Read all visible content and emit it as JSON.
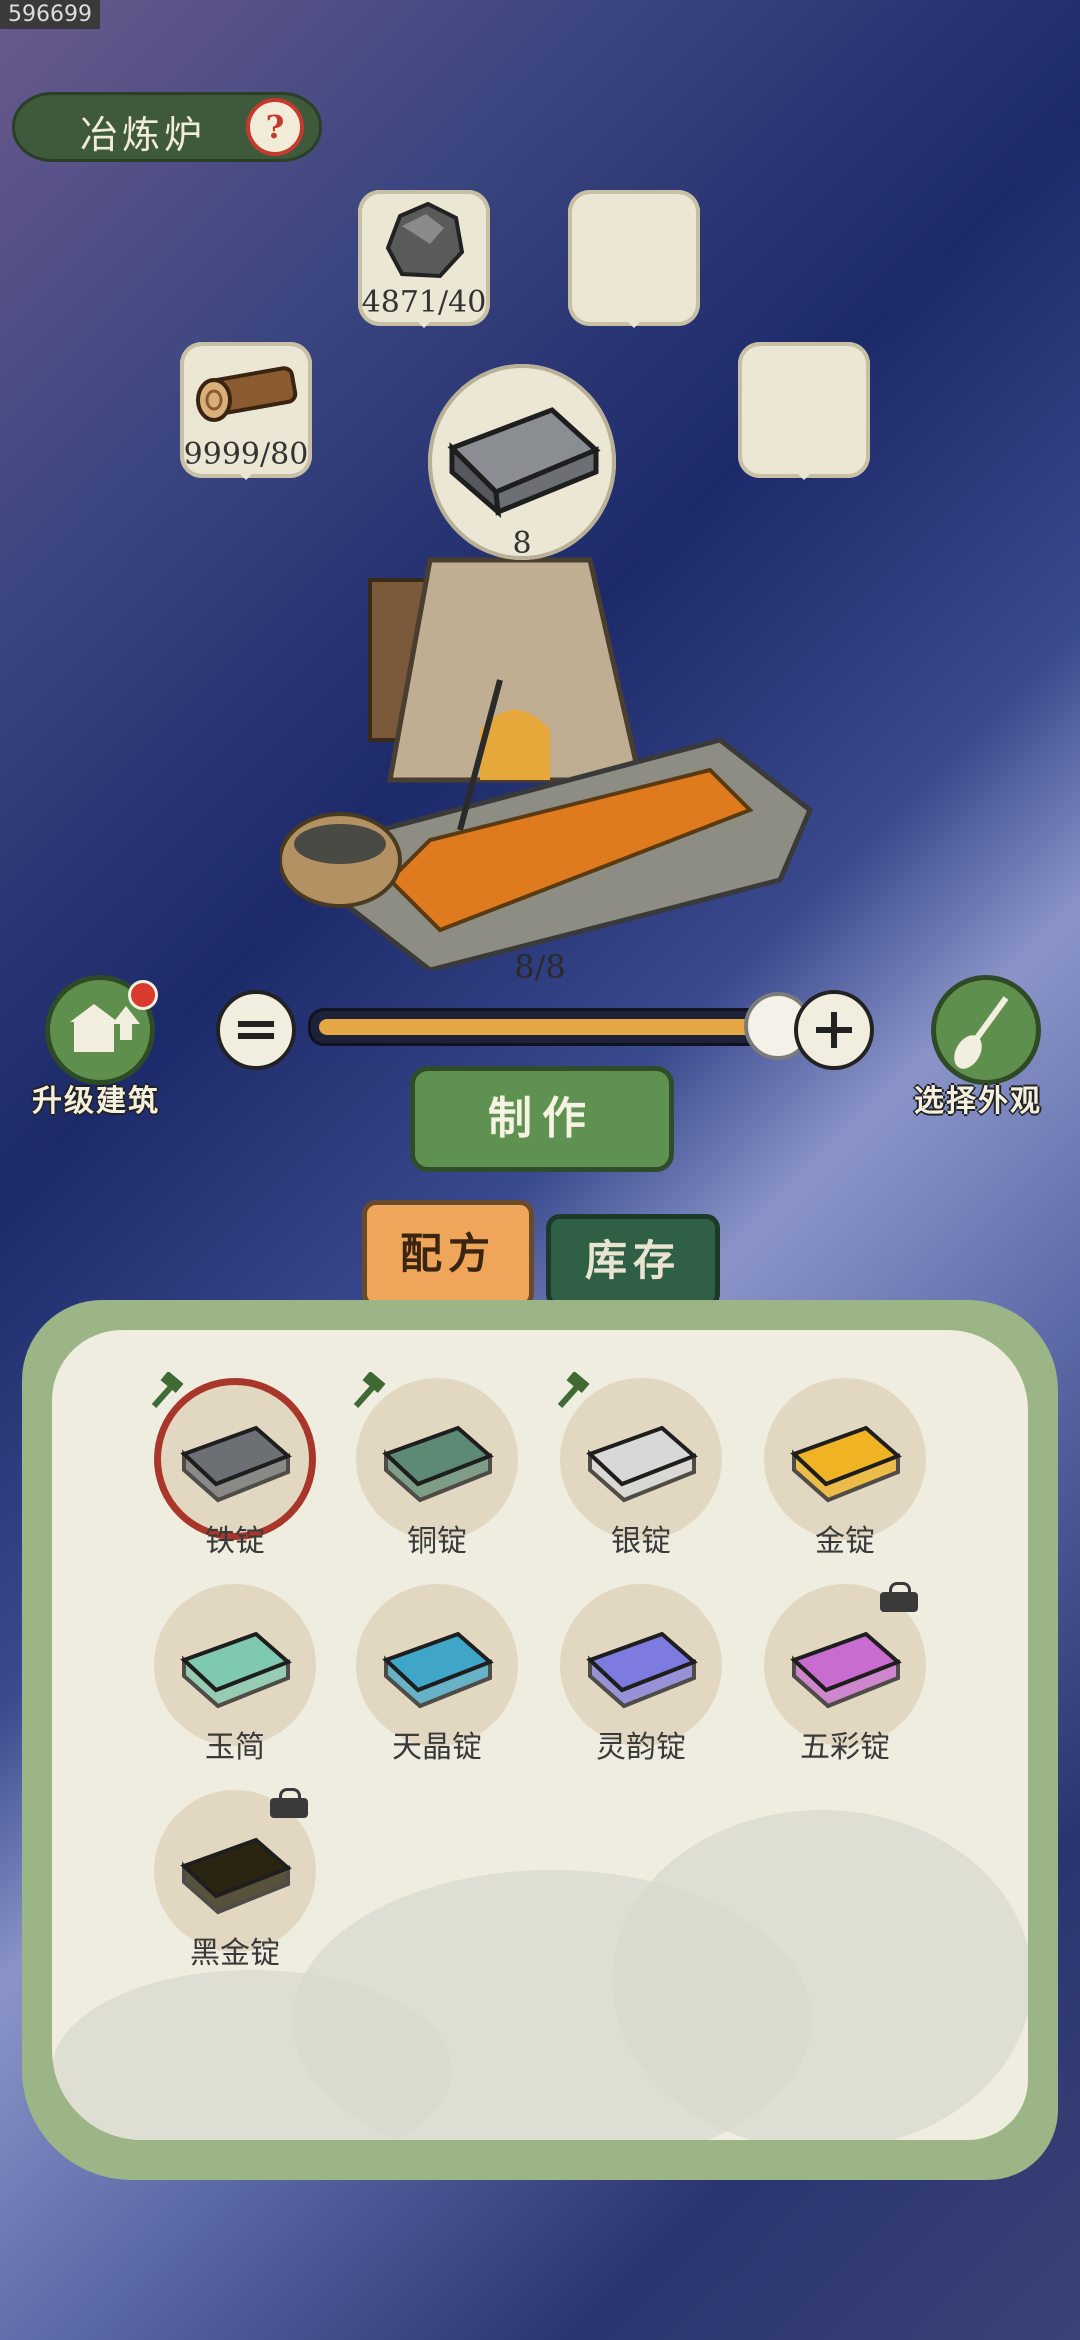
{
  "debug_id": "596699",
  "header": {
    "title": "冶炼炉",
    "help_icon": "question-icon"
  },
  "materials": [
    {
      "icon": "ore-icon",
      "count": "4871/40"
    },
    {
      "icon": "",
      "count": ""
    },
    {
      "icon": "log-icon",
      "count": "9999/80"
    },
    {
      "icon": "",
      "count": ""
    }
  ],
  "output": {
    "icon": "iron-ingot-icon",
    "count": "8"
  },
  "batch": {
    "display": "8/8",
    "current": 8,
    "max": 8
  },
  "actions": {
    "upgrade_label": "升级建筑",
    "appearance_label": "选择外观",
    "make_label": "制作"
  },
  "tabs": [
    {
      "label": "配方",
      "active": true
    },
    {
      "label": "库存",
      "active": false
    }
  ],
  "recipes": [
    {
      "name": "铁锭",
      "color": "#6c6f74",
      "hammer": true,
      "selected": true,
      "locked": false
    },
    {
      "name": "铜锭",
      "color": "#5d8a74",
      "hammer": true,
      "selected": false,
      "locked": false
    },
    {
      "name": "银锭",
      "color": "#d8d8d8",
      "hammer": true,
      "selected": false,
      "locked": false
    },
    {
      "name": "金锭",
      "color": "#f0b324",
      "hammer": false,
      "selected": false,
      "locked": false
    },
    {
      "name": "玉简",
      "color": "#7fc9b0",
      "hammer": false,
      "selected": false,
      "locked": false
    },
    {
      "name": "天晶锭",
      "color": "#3fa6c8",
      "hammer": false,
      "selected": false,
      "locked": false
    },
    {
      "name": "灵韵锭",
      "color": "#7e7be0",
      "hammer": false,
      "selected": false,
      "locked": false
    },
    {
      "name": "五彩锭",
      "color": "#c86cd0",
      "hammer": false,
      "selected": false,
      "locked": true
    },
    {
      "name": "黑金锭",
      "color": "#2a2410",
      "hammer": false,
      "selected": false,
      "locked": true
    }
  ]
}
